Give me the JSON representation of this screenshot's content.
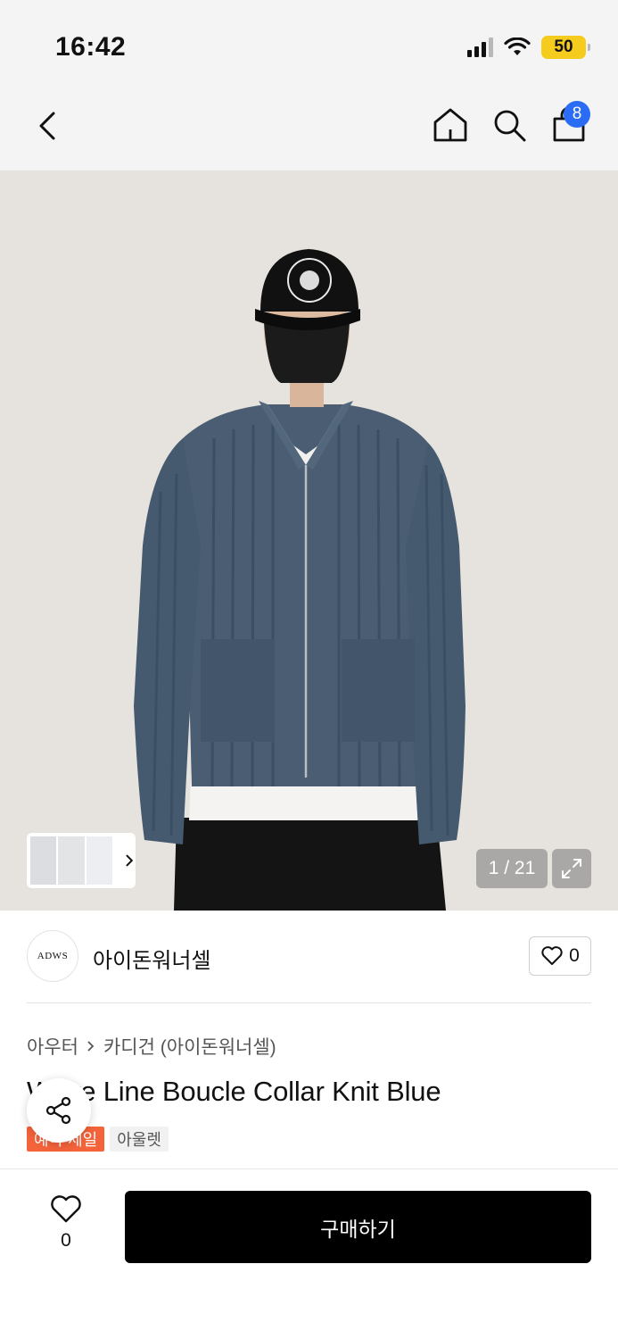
{
  "status_bar": {
    "time": "16:42",
    "battery": "50"
  },
  "nav": {
    "cart_count": "8"
  },
  "gallery": {
    "counter": "1 / 21"
  },
  "brand": {
    "logo_text": "ADWS",
    "name": "아이돈워너셀",
    "like_count": "0"
  },
  "breadcrumb": {
    "level1": "아우터",
    "level2": "카디건 (아이돈워너셀)"
  },
  "product": {
    "title": "Wave Line Boucle Collar Knit Blue",
    "tags": [
      "예약 세일",
      "아울렛"
    ]
  },
  "bottom_bar": {
    "like_count": "0",
    "buy_label": "구매하기"
  },
  "colors": {
    "accent_badge": "#2a6df4",
    "sale_tag": "#f4633a",
    "battery": "#f5cc1d",
    "buy_button": "#000000"
  },
  "icons": [
    "back-icon",
    "home-icon",
    "search-icon",
    "bag-icon",
    "chevron-right-icon",
    "expand-icon",
    "heart-icon",
    "share-icon"
  ]
}
